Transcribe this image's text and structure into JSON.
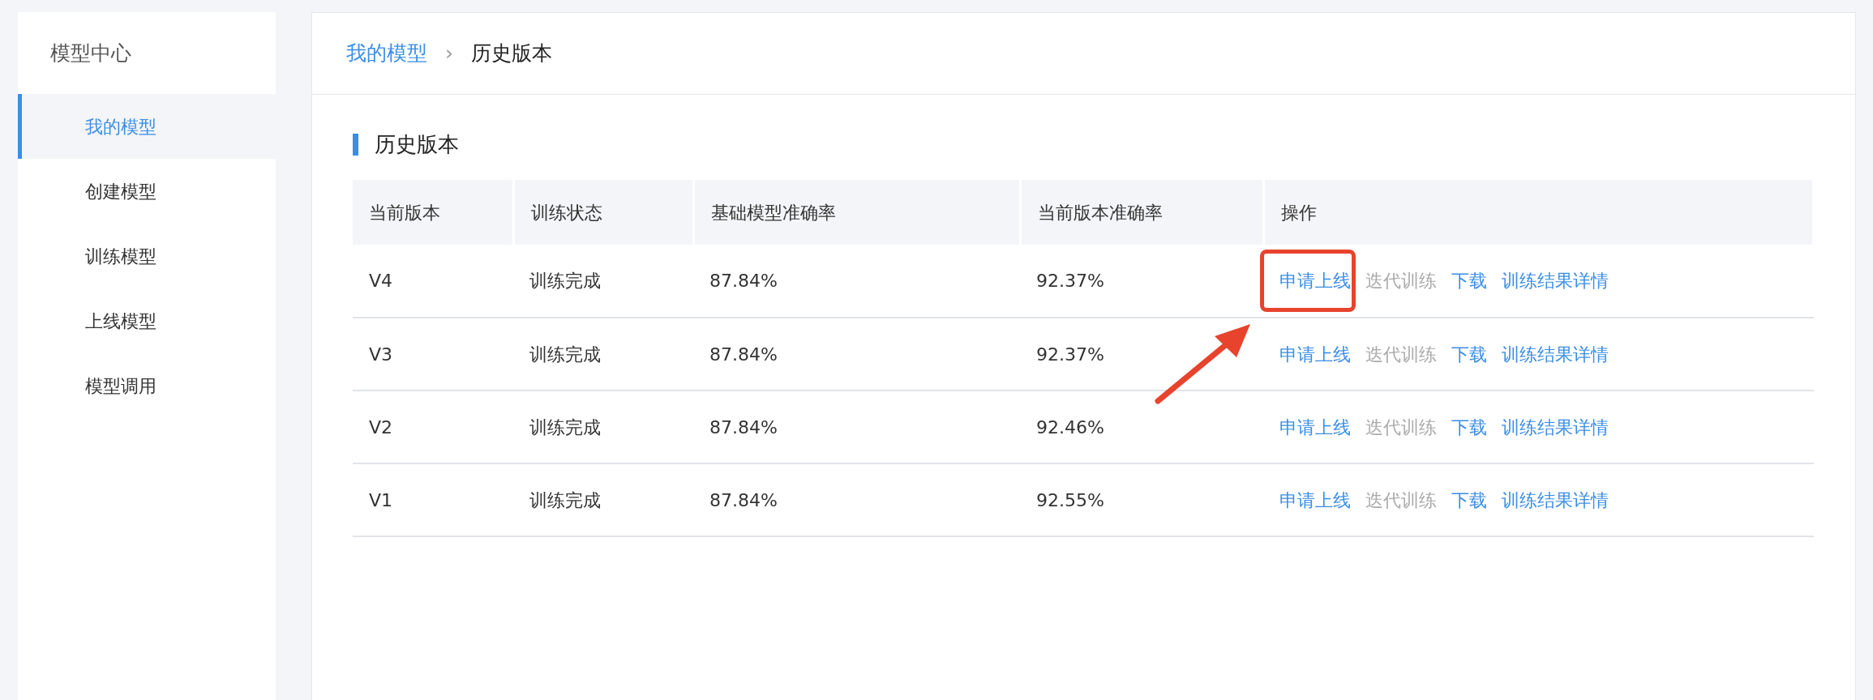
{
  "sidebar": {
    "title": "模型中心",
    "items": [
      {
        "label": "我的模型",
        "selected": true
      },
      {
        "label": "创建模型",
        "selected": false
      },
      {
        "label": "训练模型",
        "selected": false
      },
      {
        "label": "上线模型",
        "selected": false
      },
      {
        "label": "模型调用",
        "selected": false
      }
    ]
  },
  "breadcrumb": {
    "parent": "我的模型",
    "separator": "›",
    "current": "历史版本"
  },
  "section_title": "历史版本",
  "table": {
    "columns": [
      "当前版本",
      "训练状态",
      "基础模型准确率",
      "当前版本准确率",
      "操作"
    ],
    "rows": [
      {
        "cells": [
          "V4",
          "训练完成",
          "87.84%",
          "92.37%"
        ],
        "actions": [
          {
            "label": "申请上线",
            "disabled": false,
            "highlighted": true
          },
          {
            "label": "迭代训练",
            "disabled": true,
            "highlighted": false
          },
          {
            "label": "下载",
            "disabled": false,
            "highlighted": false
          },
          {
            "label": "训练结果详情",
            "disabled": false,
            "highlighted": false
          }
        ]
      },
      {
        "cells": [
          "V3",
          "训练完成",
          "87.84%",
          "92.37%"
        ],
        "actions": [
          {
            "label": "申请上线",
            "disabled": false,
            "highlighted": false
          },
          {
            "label": "迭代训练",
            "disabled": true,
            "highlighted": false
          },
          {
            "label": "下载",
            "disabled": false,
            "highlighted": false
          },
          {
            "label": "训练结果详情",
            "disabled": false,
            "highlighted": false
          }
        ]
      },
      {
        "cells": [
          "V2",
          "训练完成",
          "87.84%",
          "92.46%"
        ],
        "actions": [
          {
            "label": "申请上线",
            "disabled": false,
            "highlighted": false
          },
          {
            "label": "迭代训练",
            "disabled": true,
            "highlighted": false
          },
          {
            "label": "下载",
            "disabled": false,
            "highlighted": false
          },
          {
            "label": "训练结果详情",
            "disabled": false,
            "highlighted": false
          }
        ]
      },
      {
        "cells": [
          "V1",
          "训练完成",
          "87.84%",
          "92.55%"
        ],
        "actions": [
          {
            "label": "申请上线",
            "disabled": false,
            "highlighted": false
          },
          {
            "label": "迭代训练",
            "disabled": true,
            "highlighted": false
          },
          {
            "label": "下载",
            "disabled": false,
            "highlighted": false
          },
          {
            "label": "训练结果详情",
            "disabled": false,
            "highlighted": false
          }
        ]
      }
    ]
  }
}
